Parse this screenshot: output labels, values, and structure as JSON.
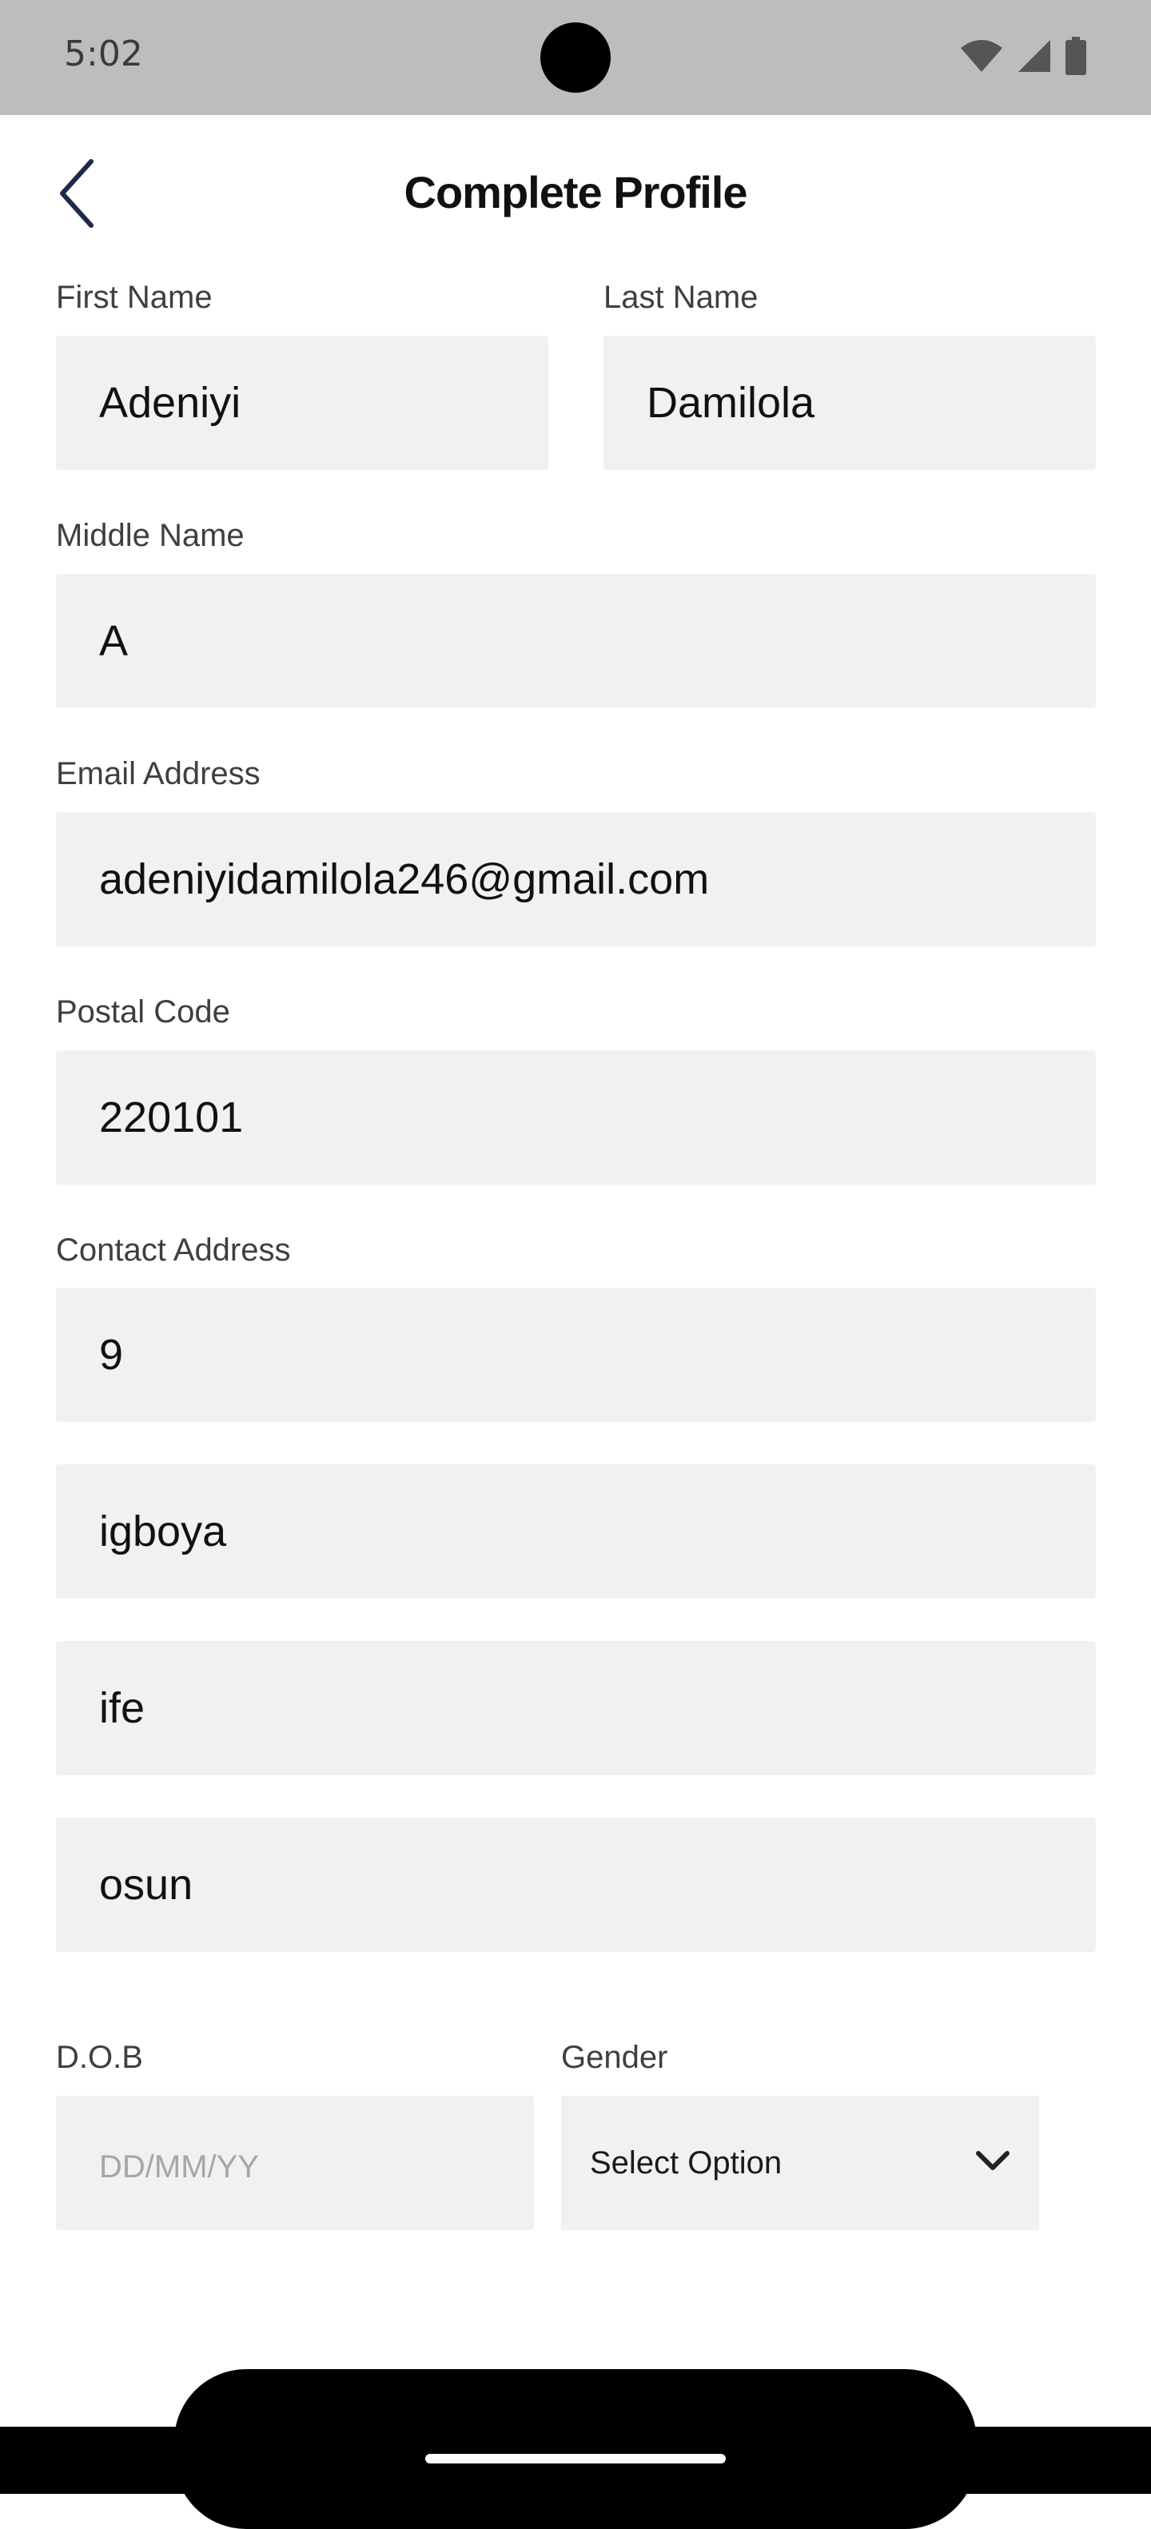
{
  "status_bar": {
    "time": "5:02",
    "icons": [
      "wifi-icon",
      "cellular-signal-icon",
      "battery-icon"
    ]
  },
  "header": {
    "back_icon": "chevron-left-icon",
    "title": "Complete Profile"
  },
  "form": {
    "first_name": {
      "label": "First Name",
      "value": "Adeniyi"
    },
    "last_name": {
      "label": "Last Name",
      "value": "Damilola"
    },
    "middle_name": {
      "label": "Middle Name",
      "value": "A"
    },
    "email": {
      "label": "Email Address",
      "value": "adeniyidamilola246@gmail.com"
    },
    "postal_code": {
      "label": "Postal Code",
      "value": "220101"
    },
    "contact_address": {
      "label": "Contact Address",
      "lines": [
        "9",
        "igboya",
        "ife",
        "osun"
      ]
    },
    "dob": {
      "label": "D.O.B",
      "value": "",
      "placeholder": "DD/MM/YY"
    },
    "gender": {
      "label": "Gender",
      "value": "Select Option",
      "icon": "chevron-down-icon"
    }
  },
  "colors": {
    "status_bar_bg": "#bdbdbd",
    "input_bg": "#f1f1f1",
    "back_icon": "#1d2a4a",
    "label_text": "#3f3f3f"
  }
}
